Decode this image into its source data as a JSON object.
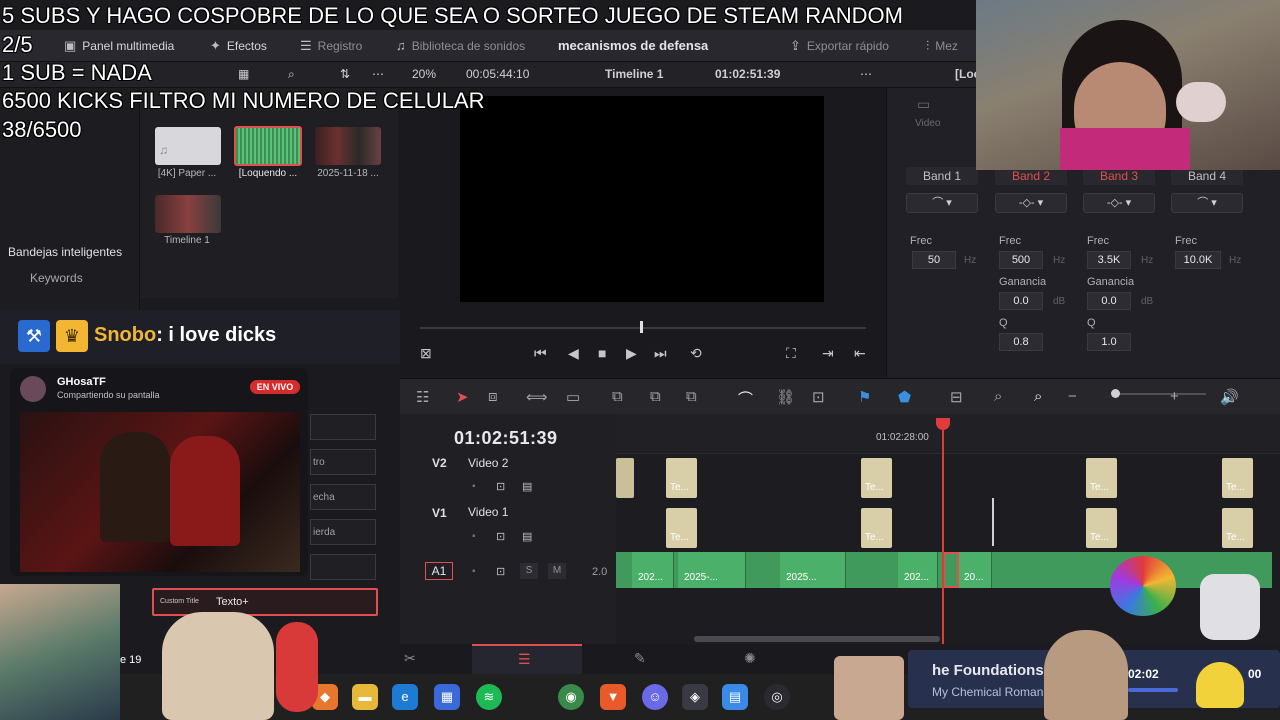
{
  "overlay": {
    "line1": "5 SUBS Y HAGO COSPOBRE DE LO QUE SEA O SORTEO JUEGO DE STEAM RANDOM",
    "line2": "2/5",
    "line3": "1 SUB = NADA",
    "line4": "6500 KICKS FILTRO MI NUMERO DE CELULAR",
    "line5": "38/6500"
  },
  "toolbar": {
    "media_panel": "Panel multimedia",
    "effects": "Efectos",
    "log": "Registro",
    "sound_library": "Biblioteca de sonidos",
    "project_title": "mecanismos de defensa",
    "quick_export": "Exportar rápido",
    "mixer": "Mez"
  },
  "viewer_bar": {
    "zoom": "20%",
    "duration": "00:05:44:10",
    "timeline_name": "Timeline 1",
    "timecode": "01:02:51:39",
    "loc": "[Loc"
  },
  "media_pool": {
    "clips": [
      {
        "label": "[4K] Paper ..."
      },
      {
        "label": "[Loquendo ..."
      },
      {
        "label": "2025-11-18 ..."
      },
      {
        "label": "Timeline 1"
      }
    ]
  },
  "smart_bins": {
    "title": "Bandejas inteligentes",
    "keywords": "Keywords"
  },
  "inspector": {
    "bands": [
      "Band 1",
      "Band 2",
      "Band 3",
      "Band 4"
    ],
    "freq_label": "Frec",
    "gain_label": "Ganancia",
    "q_label": "Q",
    "hz": "Hz",
    "db": "dB",
    "band1_freq": "50",
    "band2_freq": "500",
    "band2_gain": "0.0",
    "band2_q": "0.8",
    "band3_freq": "3.5K",
    "band3_gain": "0.0",
    "band3_q": "1.0",
    "band4_freq": "10.0K",
    "video_tab": "Video"
  },
  "timeline": {
    "timecode": "01:02:51:39",
    "ruler_mark": "01:02:28:00",
    "tracks": {
      "v2_id": "V2",
      "v2_name": "Video 2",
      "v1_id": "V1",
      "v1_name": "Video 1",
      "a1_id": "A1",
      "a1_volume": "2.0",
      "solo": "S",
      "mute": "M"
    },
    "video_clip_label": "Te...",
    "audio_clips": [
      "202...",
      "2025-...",
      "2025...",
      "202...",
      "20..."
    ]
  },
  "stream_overlay": {
    "chat_user": "Snobo",
    "chat_message": ": i love dicks",
    "card_name": "GHosaTF",
    "card_status": "Compartiendo su pantalla",
    "live_label": "EN VIVO",
    "side_items": [
      "tro",
      "echa",
      "ierda"
    ],
    "custom_title_tag": "Custom Title",
    "custom_title_text": "Texto+",
    "counter_text": "e 19",
    "music_title": "he Foundations",
    "music_artist": "My Chemical Roman",
    "music_time": "02:02",
    "music_time2": "00"
  }
}
